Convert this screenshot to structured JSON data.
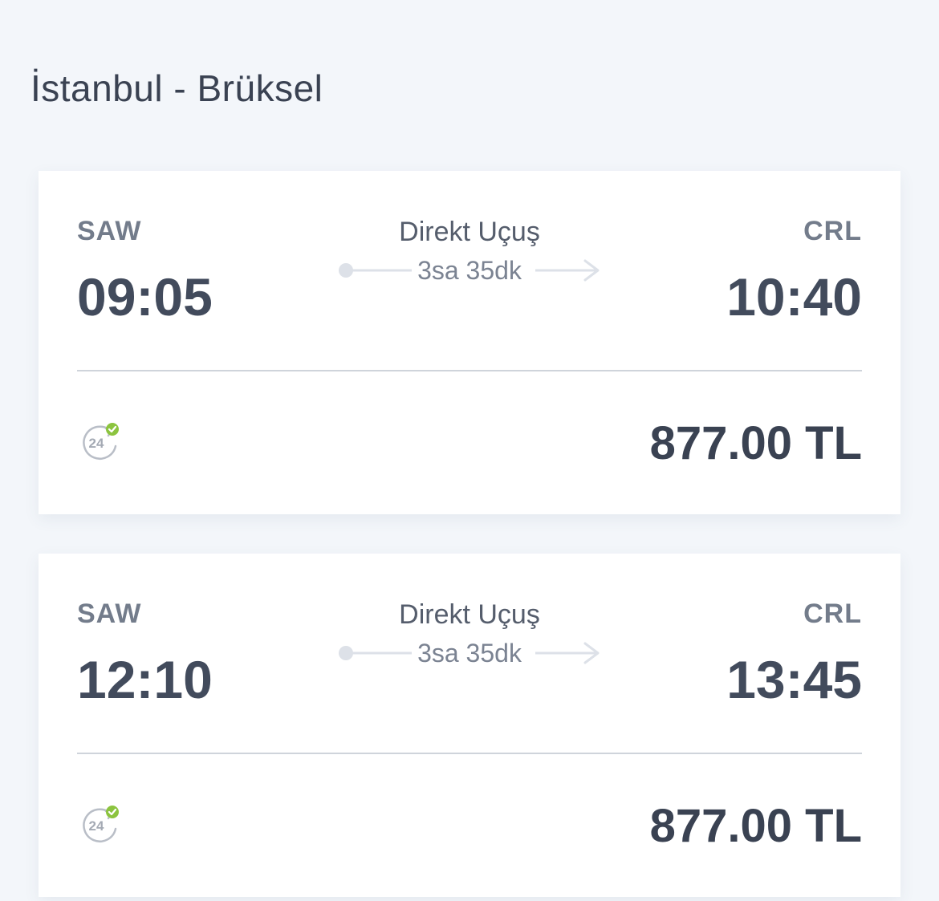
{
  "route": {
    "title": "İstanbul - Brüksel"
  },
  "flights": [
    {
      "departure_code": "SAW",
      "departure_time": "09:05",
      "flight_type": "Direkt Uçuş",
      "duration": "3sa 35dk",
      "arrival_code": "CRL",
      "arrival_time": "10:40",
      "badge_icon": "24h-refund-icon",
      "badge_text": "24",
      "price": "877.00 TL"
    },
    {
      "departure_code": "SAW",
      "departure_time": "12:10",
      "flight_type": "Direkt Uçuş",
      "duration": "3sa 35dk",
      "arrival_code": "CRL",
      "arrival_time": "13:45",
      "badge_icon": "24h-refund-icon",
      "badge_text": "24",
      "price": "877.00 TL"
    }
  ],
  "colors": {
    "background": "#f3f6fa",
    "card": "#ffffff",
    "text_dark": "#424b5c",
    "text_muted": "#737c8b",
    "check_green": "#8cc43f"
  }
}
